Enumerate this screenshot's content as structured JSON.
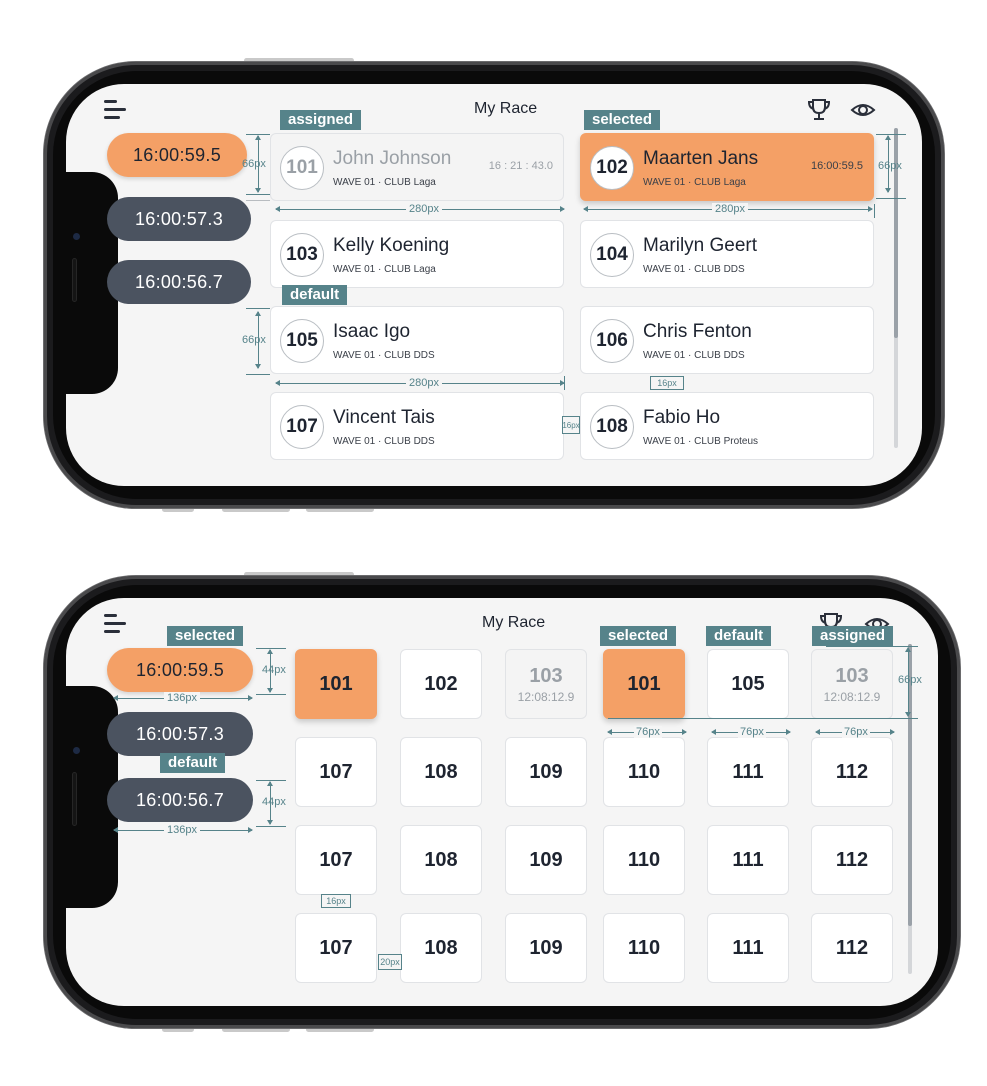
{
  "app": {
    "title": "My Race"
  },
  "icons": {
    "menu": "hamburger-menu-icon",
    "trophy": "trophy-icon",
    "eye": "eye-icon"
  },
  "colors": {
    "selected": "#f4a066",
    "dark_pill": "#4b5360",
    "annotation": "#56838a",
    "assigned_text": "#9aa0a6"
  },
  "screen1": {
    "times": [
      {
        "value": "16:00:59.5",
        "state": "selected"
      },
      {
        "value": "16:00:57.3",
        "state": "default"
      },
      {
        "value": "16:00:56.7",
        "state": "default"
      }
    ],
    "runners": [
      {
        "bib": "101",
        "name": "John Johnson",
        "info": "WAVE 01 · CLUB Laga",
        "time": "16 : 21 : 43.0",
        "state": "assigned"
      },
      {
        "bib": "102",
        "name": "Maarten Jans",
        "info": "WAVE 01 · CLUB Laga",
        "time": "16:00:59.5",
        "state": "selected"
      },
      {
        "bib": "103",
        "name": "Kelly Koening",
        "info": "WAVE 01 · CLUB Laga",
        "time": "",
        "state": "default"
      },
      {
        "bib": "104",
        "name": "Marilyn Geert",
        "info": "WAVE 01 · CLUB DDS",
        "time": "",
        "state": "default"
      },
      {
        "bib": "105",
        "name": "Isaac Igo",
        "info": "WAVE 01 · CLUB DDS",
        "time": "",
        "state": "default"
      },
      {
        "bib": "106",
        "name": "Chris Fenton",
        "info": "WAVE 01 · CLUB DDS",
        "time": "",
        "state": "default"
      },
      {
        "bib": "107",
        "name": "Vincent Tais",
        "info": "WAVE 01 · CLUB DDS",
        "time": "",
        "state": "default"
      },
      {
        "bib": "108",
        "name": "Fabio Ho",
        "info": "WAVE 01 · CLUB Proteus",
        "time": "",
        "state": "default"
      }
    ],
    "annotations": {
      "tag_assigned": "assigned",
      "tag_selected": "selected",
      "tag_default": "default",
      "height_66": "66px",
      "width_280": "280px",
      "gap_16": "16px"
    }
  },
  "screen2": {
    "times": [
      {
        "value": "16:00:59.5",
        "state": "selected"
      },
      {
        "value": "16:00:57.3",
        "state": "default"
      },
      {
        "value": "16:00:56.7",
        "state": "default"
      }
    ],
    "tiles": [
      {
        "bib": "101",
        "state": "selected",
        "time": ""
      },
      {
        "bib": "102",
        "state": "default",
        "time": ""
      },
      {
        "bib": "103",
        "state": "assigned",
        "time": "12:08:12.9"
      },
      {
        "bib": "101",
        "state": "selected",
        "time": ""
      },
      {
        "bib": "105",
        "state": "default",
        "time": ""
      },
      {
        "bib": "103",
        "state": "assigned",
        "time": "12:08:12.9"
      },
      {
        "bib": "107",
        "state": "default",
        "time": ""
      },
      {
        "bib": "108",
        "state": "default",
        "time": ""
      },
      {
        "bib": "109",
        "state": "default",
        "time": ""
      },
      {
        "bib": "110",
        "state": "default",
        "time": ""
      },
      {
        "bib": "111",
        "state": "default",
        "time": ""
      },
      {
        "bib": "112",
        "state": "default",
        "time": ""
      },
      {
        "bib": "107",
        "state": "default",
        "time": ""
      },
      {
        "bib": "108",
        "state": "default",
        "time": ""
      },
      {
        "bib": "109",
        "state": "default",
        "time": ""
      },
      {
        "bib": "110",
        "state": "default",
        "time": ""
      },
      {
        "bib": "111",
        "state": "default",
        "time": ""
      },
      {
        "bib": "112",
        "state": "default",
        "time": ""
      },
      {
        "bib": "107",
        "state": "default",
        "time": ""
      },
      {
        "bib": "108",
        "state": "default",
        "time": ""
      },
      {
        "bib": "109",
        "state": "default",
        "time": ""
      },
      {
        "bib": "110",
        "state": "default",
        "time": ""
      },
      {
        "bib": "111",
        "state": "default",
        "time": ""
      },
      {
        "bib": "112",
        "state": "default",
        "time": ""
      }
    ],
    "annotations": {
      "tag_selected": "selected",
      "tag_default": "default",
      "tag_assigned": "assigned",
      "height_44": "44px",
      "height_66": "66px",
      "width_136": "136px",
      "width_76": "76px",
      "gap_16": "16px",
      "gap_20": "20px"
    }
  }
}
